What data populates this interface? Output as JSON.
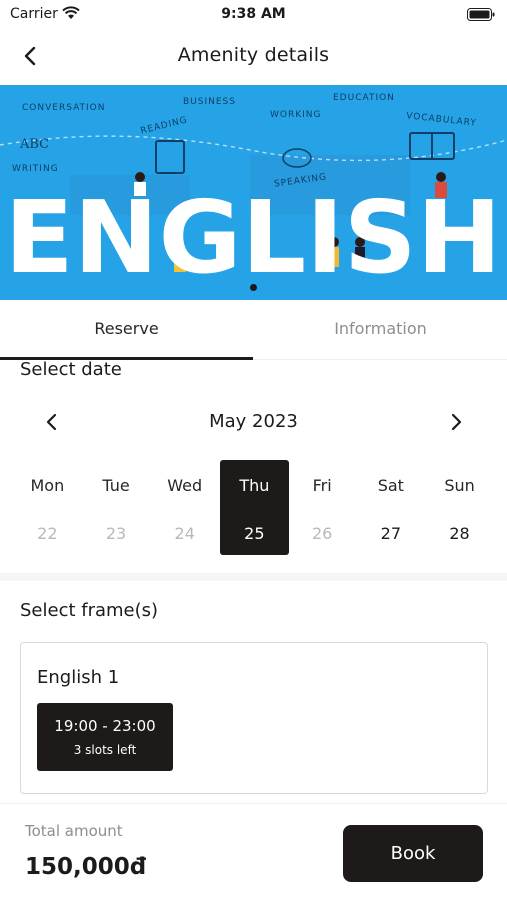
{
  "status_bar": {
    "carrier": "Carrier",
    "time": "9:38 AM"
  },
  "nav": {
    "title": "Amenity details"
  },
  "banner": {
    "headline": "ENGLISH",
    "words": [
      "CONVERSATION",
      "BUSINESS",
      "WORKING",
      "EDUCATION",
      "READING",
      "VOCABULARY",
      "ABC",
      "WRITING",
      "SPEAKING"
    ],
    "background_color": "#25a3e6",
    "page_count": 1,
    "current_page": 1
  },
  "tabs": [
    {
      "label": "Reserve",
      "active": true
    },
    {
      "label": "Information",
      "active": false
    }
  ],
  "date_section": {
    "title": "Select date",
    "month": "May 2023",
    "days": [
      {
        "name": "Mon",
        "num": "22",
        "state": "past"
      },
      {
        "name": "Tue",
        "num": "23",
        "state": "past"
      },
      {
        "name": "Wed",
        "num": "24",
        "state": "past"
      },
      {
        "name": "Thu",
        "num": "25",
        "state": "selected"
      },
      {
        "name": "Fri",
        "num": "26",
        "state": "past"
      },
      {
        "name": "Sat",
        "num": "27",
        "state": "future"
      },
      {
        "name": "Sun",
        "num": "28",
        "state": "future"
      }
    ]
  },
  "frame_section": {
    "title": "Select frame(s)",
    "frames": [
      {
        "name": "English 1",
        "slots": [
          {
            "time": "19:00 - 23:00",
            "availability": "3 slots left"
          }
        ]
      }
    ]
  },
  "footer": {
    "total_label": "Total amount",
    "total_amount": "150,000đ",
    "book_label": "Book"
  },
  "colors": {
    "primary": "#1f1a1a",
    "muted": "#8e8e8e",
    "disabled": "#b9b9b9",
    "banner": "#25a3e6"
  }
}
